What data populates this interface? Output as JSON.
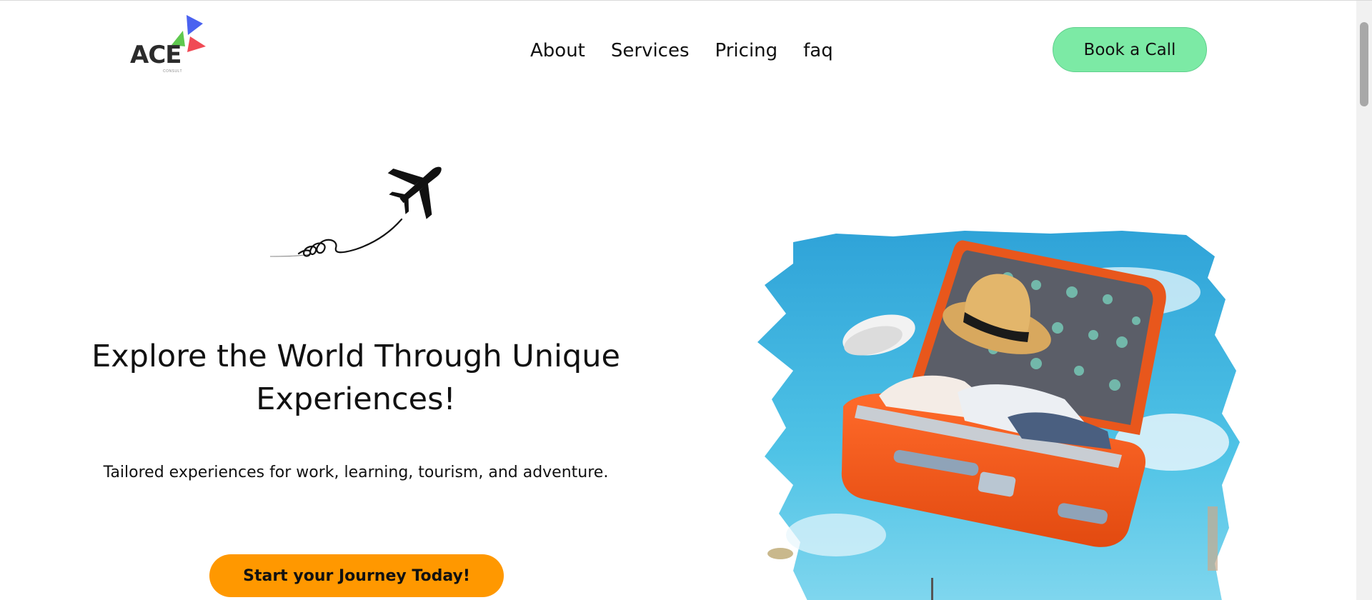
{
  "brand": {
    "name": "ACE",
    "tagline": "CONSULT"
  },
  "nav": {
    "items": [
      {
        "label": "About"
      },
      {
        "label": "Services"
      },
      {
        "label": "Pricing"
      },
      {
        "label": "faq"
      }
    ]
  },
  "header": {
    "book_label": "Book a Call"
  },
  "hero": {
    "title": "Explore the World Through Unique Experiences!",
    "subtitle": "Tailored experiences for work, learning, tourism, and adventure.",
    "cta_label": "Start your Journey Today!"
  },
  "colors": {
    "book_button": "#7ceaa5",
    "cta_button": "#ff9800",
    "logo_blue": "#4a62f0",
    "logo_green": "#5ec84e",
    "logo_red": "#f04a55"
  },
  "icons": {
    "logo": "ace-logo-icon",
    "airplane": "airplane-icon",
    "hero": "open-suitcase-image"
  }
}
